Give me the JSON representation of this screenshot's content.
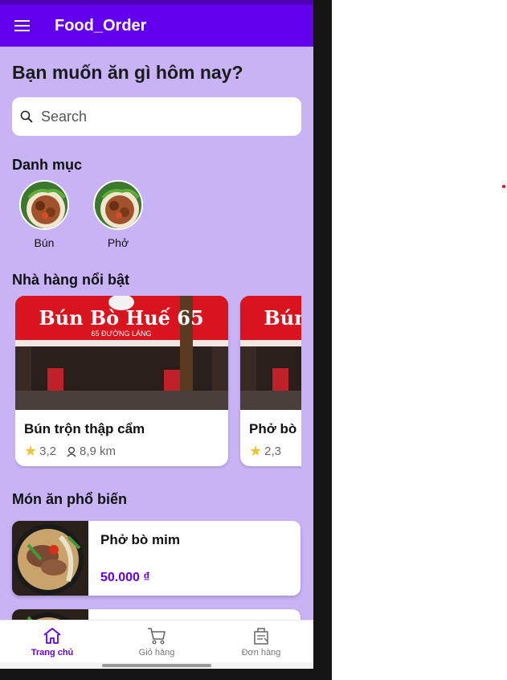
{
  "app": {
    "title": "Food_Order"
  },
  "home": {
    "greeting": "Bạn muốn ăn gì hôm nay?",
    "search_placeholder": "Search"
  },
  "categories": {
    "title": "Danh mục",
    "items": [
      {
        "label": "Bún"
      },
      {
        "label": "Phở"
      }
    ]
  },
  "restaurants": {
    "title": "Nhà hàng nổi bật",
    "sign_text": "Bún Bò Huế 65",
    "sign_sub": "65 ĐƯỜNG LÁNG",
    "items": [
      {
        "name": "Bún trộn thập cẩm",
        "rating": "3,2",
        "distance": "8,9 km"
      },
      {
        "name": "Phở bò nạm",
        "rating": "2,3",
        "distance": ""
      }
    ]
  },
  "popular": {
    "title": "Món ăn phổ biến",
    "items": [
      {
        "name": "Phở bò mim",
        "price": "50.000 ₫"
      },
      {
        "name": "",
        "price": ""
      }
    ]
  },
  "bottom_nav": {
    "items": [
      {
        "label": "Trang chủ",
        "icon": "home-icon",
        "active": true
      },
      {
        "label": "Giỏ hàng",
        "icon": "cart-icon",
        "active": false
      },
      {
        "label": "Đơn hàng",
        "icon": "orders-icon",
        "active": false
      }
    ]
  },
  "colors": {
    "primary": "#6200ee",
    "background": "#c8b3f5",
    "star": "#f2c230"
  }
}
